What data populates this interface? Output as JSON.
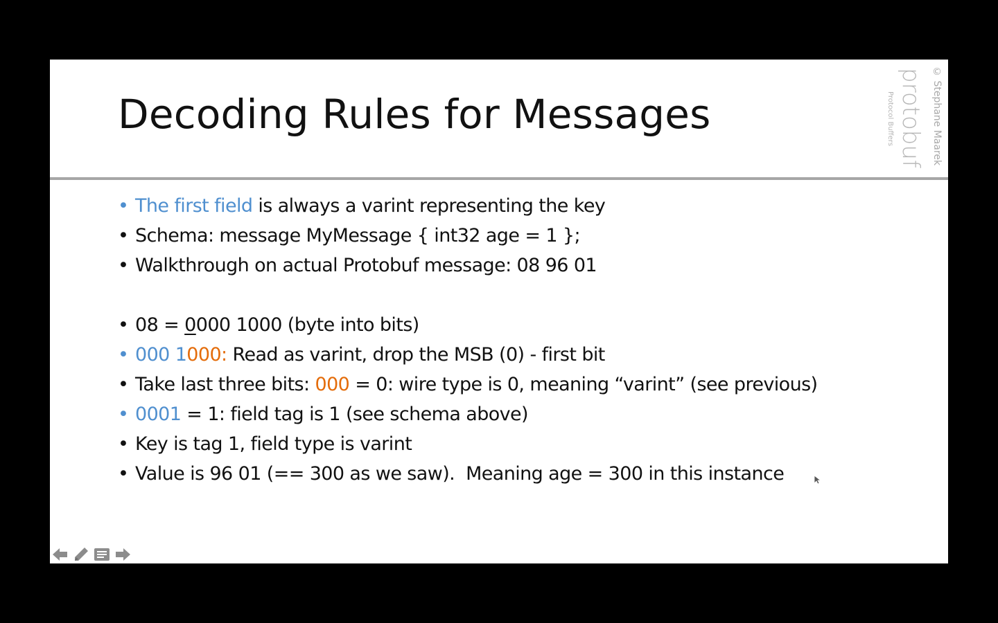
{
  "slide": {
    "title": "Decoding Rules for Messages",
    "watermark": {
      "copyright": "© Stephane Maarek",
      "brand": "protobuf",
      "subtitle": "Protocol Buffers"
    },
    "bullets": [
      {
        "parts": [
          {
            "text": "The first field",
            "color": "blue"
          },
          {
            "text": " is always a varint representing the key"
          }
        ]
      },
      {
        "parts": [
          {
            "text": "Schema: message MyMessage { int32 age = 1 };"
          }
        ]
      },
      {
        "parts": [
          {
            "text": "Walkthrough on actual Protobuf message: 08 96 01"
          }
        ]
      },
      {
        "spacer": true
      },
      {
        "parts": [
          {
            "text": "08 = "
          },
          {
            "text": "0",
            "underline": true
          },
          {
            "text": "000 1000 (byte into bits)"
          }
        ]
      },
      {
        "parts": [
          {
            "text": "000 1",
            "color": "blue"
          },
          {
            "text": "000:",
            "color": "orange"
          },
          {
            "text": " Read as varint, drop the MSB (0) - first bit"
          }
        ]
      },
      {
        "parts": [
          {
            "text": "Take last three bits: "
          },
          {
            "text": "000",
            "color": "orange"
          },
          {
            "text": " = 0: wire type is 0, meaning “varint” (see previous)"
          }
        ]
      },
      {
        "parts": [
          {
            "text": "0001",
            "color": "blue"
          },
          {
            "text": " = 1: field tag is 1 (see schema above)"
          }
        ]
      },
      {
        "parts": [
          {
            "text": "Key is tag 1, field type is varint"
          }
        ]
      },
      {
        "parts": [
          {
            "text": "Value is 96 01 (== 300 as we saw).  Meaning age = 300 in this instance"
          }
        ]
      }
    ],
    "bullet_char": "•"
  },
  "nav": {
    "icons": [
      "arrow-left-icon",
      "pen-icon",
      "notes-icon",
      "arrow-right-icon"
    ]
  },
  "colors": {
    "background": "#000000",
    "slide": "#ffffff",
    "blue": "#4f8fcf",
    "orange": "#e46c0a",
    "divider": "#a6a6a6",
    "nav_icon": "#8c8c8c"
  }
}
